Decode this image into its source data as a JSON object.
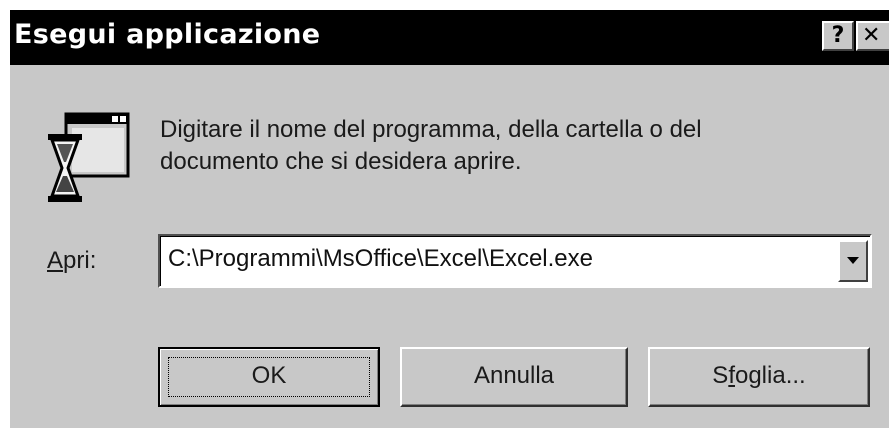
{
  "window": {
    "title": "Esegui applicazione",
    "help_glyph": "?",
    "close_glyph": "✕",
    "background": "#c8c8c8",
    "titlebar_color": "#000000"
  },
  "instruction": {
    "line1": "Digitare il nome del programma, della cartella o del",
    "line2": "documento che si desidera aprire.",
    "icon": "run-program-icon"
  },
  "open_field": {
    "label_mnemonic": "A",
    "label_rest": "pri:",
    "value": "C:\\Programmi\\MsOffice\\Excel\\Excel.exe",
    "arrow_icon": "chevron-down-icon"
  },
  "buttons": {
    "ok": "OK",
    "cancel": "Annulla",
    "browse_pre": "S",
    "browse_mnemonic": "f",
    "browse_post": "oglia..."
  }
}
